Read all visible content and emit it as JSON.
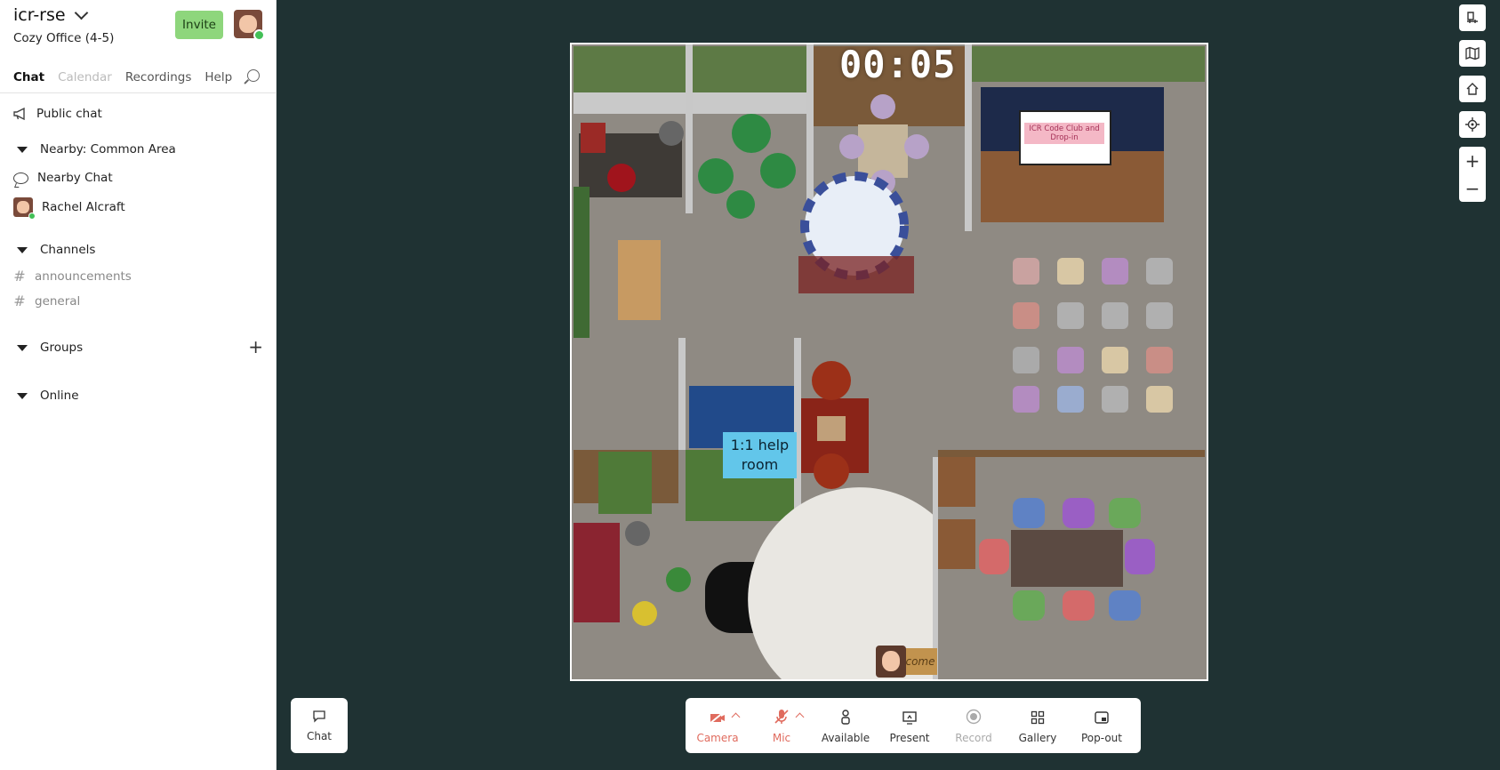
{
  "workspace": {
    "name": "icr-rse",
    "space": "Cozy Office (4-5)",
    "invite_label": "Invite"
  },
  "tabs": [
    {
      "label": "Chat"
    },
    {
      "label": "Calendar"
    },
    {
      "label": "Recordings"
    },
    {
      "label": "Help"
    }
  ],
  "sidebar": {
    "public_chat": "Public chat",
    "nearby_header": "Nearby: Common Area",
    "nearby_chat": "Nearby Chat",
    "nearby_user": "Rachel Alcraft",
    "channels_header": "Channels",
    "channels": [
      {
        "name": "announcements"
      },
      {
        "name": "general"
      }
    ],
    "groups_header": "Groups",
    "online_header": "Online"
  },
  "map": {
    "timer": "00:05",
    "help_sign": "1:1 help room",
    "screen_label": "ICR Code Club and Drop-in",
    "welcome_mat": "come"
  },
  "bottom": {
    "chat_label": "Chat",
    "tools": [
      {
        "label": "Camera"
      },
      {
        "label": "Mic"
      },
      {
        "label": "Available"
      },
      {
        "label": "Present"
      },
      {
        "label": "Record"
      },
      {
        "label": "Gallery"
      },
      {
        "label": "Pop-out"
      }
    ]
  },
  "colors": {
    "stage_bg": "#1f3233",
    "invite_bg": "#8ed67c",
    "muted_red": "#e06b5e",
    "online_green": "#43c057",
    "help_sign_bg": "#62c6ea"
  }
}
